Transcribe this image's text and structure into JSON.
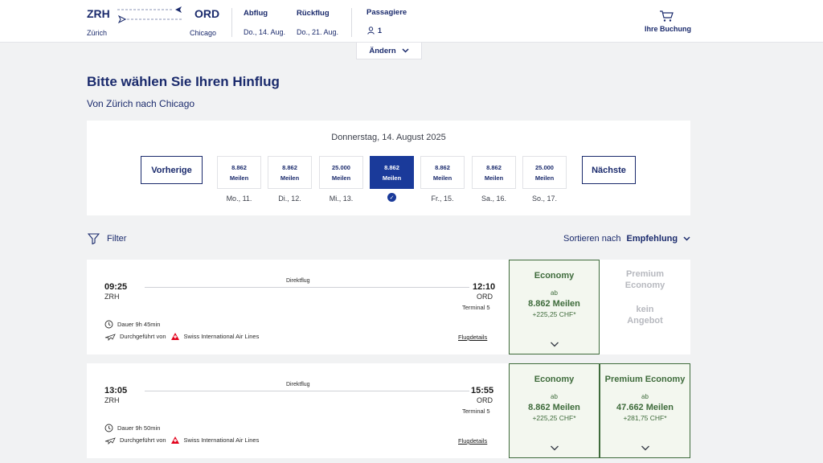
{
  "header": {
    "origin_code": "ZRH",
    "origin_city": "Zürich",
    "dest_code": "ORD",
    "dest_city": "Chicago",
    "depart_label": "Abflug",
    "depart_value": "Do., 14. Aug.",
    "return_label": "Rückflug",
    "return_value": "Do., 21. Aug.",
    "passengers_label": "Passagiere",
    "passengers_value": "1",
    "booking_label": "Ihre Buchung",
    "change_label": "Ändern"
  },
  "page": {
    "title": "Bitte wählen Sie Ihren Hinflug",
    "subtitle": "Von Zürich nach Chicago"
  },
  "date_selector": {
    "heading": "Donnerstag, 14. August 2025",
    "prev_label": "Vorherige",
    "next_label": "Nächste",
    "unit": "Meilen",
    "days": [
      {
        "price": "8.862",
        "label": "Mo., 11."
      },
      {
        "price": "8.862",
        "label": "Di., 12."
      },
      {
        "price": "25.000",
        "label": "Mi., 13."
      },
      {
        "price": "8.862",
        "label": ""
      },
      {
        "price": "8.862",
        "label": "Fr., 15."
      },
      {
        "price": "8.862",
        "label": "Sa., 16."
      },
      {
        "price": "25.000",
        "label": "So., 17."
      }
    ]
  },
  "toolbar": {
    "filter_label": "Filter",
    "sort_prefix": "Sortieren nach",
    "sort_value": "Empfehlung"
  },
  "flights": [
    {
      "dep_time": "09:25",
      "dep_airport": "ZRH",
      "arr_time": "12:10",
      "arr_airport": "ORD",
      "terminal": "Terminal 5",
      "type": "Direktflug",
      "duration": "Dauer 9h 45min",
      "operated_prefix": "Durchgeführt von",
      "airline": "Swiss International Air Lines",
      "details_label": "Flugdetails",
      "economy": {
        "class": "Economy",
        "ab": "ab",
        "miles": "8.862 Meilen",
        "chf": "+225,25 CHF*"
      },
      "premium": {
        "class_line1": "Premium",
        "class_line2": "Economy",
        "na_line1": "kein",
        "na_line2": "Angebot"
      }
    },
    {
      "dep_time": "13:05",
      "dep_airport": "ZRH",
      "arr_time": "15:55",
      "arr_airport": "ORD",
      "terminal": "Terminal 5",
      "type": "Direktflug",
      "duration": "Dauer 9h 50min",
      "operated_prefix": "Durchgeführt von",
      "airline": "Swiss International Air Lines",
      "details_label": "Flugdetails",
      "economy": {
        "class": "Economy",
        "ab": "ab",
        "miles": "8.862 Meilen",
        "chf": "+225,25 CHF*"
      },
      "premium": {
        "class": "Premium Economy",
        "ab": "ab",
        "miles": "47.662 Meilen",
        "chf": "+281,75 CHF*"
      }
    }
  ],
  "colors": {
    "brand_navy": "#1a2a6c",
    "selected_blue": "#1a3a9a",
    "fare_green": "#3e6b3b",
    "swiss_red": "#e2001a"
  }
}
